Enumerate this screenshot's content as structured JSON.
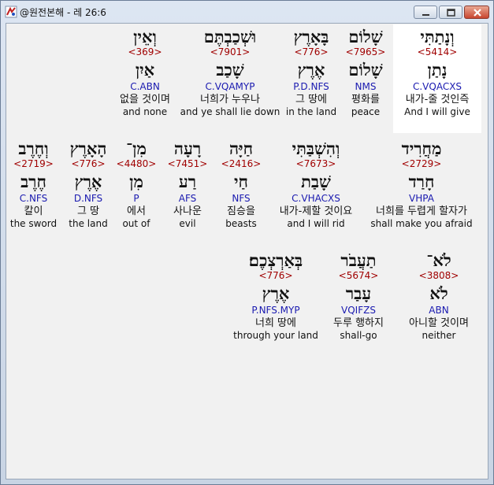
{
  "window": {
    "title": "@원전본해 - 레 26:6",
    "app_icon": "bible-app-icon",
    "buttons": {
      "minimize": "minimize-icon",
      "maximize": "maximize-icon",
      "close": "close-icon"
    }
  },
  "colors": {
    "strong": "#a00000",
    "morph": "#1a1ab0",
    "highlight": "#ffffff",
    "background": "#f1f1f1"
  },
  "words": [
    {
      "heb": "וְנָתַתִּי",
      "strong": "<5414>",
      "lemma": "נָתַן",
      "morph": "C.VQACXS",
      "kor": "내가-줄 것인즉",
      "eng": "And I will give",
      "selected": true
    },
    {
      "heb": "שָׁלוֹם",
      "strong": "<7965>",
      "lemma": "שָׁלוֹם",
      "morph": "NMS",
      "kor": "평화를",
      "eng": "peace"
    },
    {
      "heb": "בָּאָרֶץ",
      "strong": "<776>",
      "lemma": "אֶרֶץ",
      "morph": "P.D.NFS",
      "kor": "그 땅에",
      "eng": "in the land"
    },
    {
      "heb": "וּשְׁכַבְתֶּם",
      "strong": "<7901>",
      "lemma": "שָׁכַב",
      "morph": "C.VQAMYP",
      "kor": "너희가 누우나",
      "eng": "and ye shall lie down"
    },
    {
      "heb": "וְאֵין",
      "strong": "<369>",
      "lemma": "אַיִן",
      "morph": "C.ABN",
      "kor": "없을 것이며",
      "eng": "and none"
    },
    {
      "heb": "מַחֲרִיד",
      "strong": "<2729>",
      "lemma": "חָרַד",
      "morph": "VHPA",
      "kor": "너희를 두렵게 할자가",
      "eng": "shall make you afraid"
    },
    {
      "heb": "וְהִשְׁבַּתִּי",
      "strong": "<7673>",
      "lemma": "שָׁבַת",
      "morph": "C.VHACXS",
      "kor": "내가-제할 것이요",
      "eng": "and I will rid"
    },
    {
      "heb": "חַיָּה",
      "strong": "<2416>",
      "lemma": "חַי",
      "morph": "NFS",
      "kor": "짐승을",
      "eng": "beasts"
    },
    {
      "heb": "רָעָה",
      "strong": "<7451>",
      "lemma": "רַע",
      "morph": "AFS",
      "kor": "사나운",
      "eng": "evil"
    },
    {
      "heb": "מִן־",
      "strong": "<4480>",
      "lemma": "מִן",
      "morph": "P",
      "kor": "에서",
      "eng": "out of"
    },
    {
      "heb": "הָאָרֶץ",
      "strong": "<776>",
      "lemma": "אֶרֶץ",
      "morph": "D.NFS",
      "kor": "그 땅",
      "eng": "the land"
    },
    {
      "heb": "וְחֶרֶב",
      "strong": "<2719>",
      "lemma": "חֶרֶב",
      "morph": "C.NFS",
      "kor": "칼이",
      "eng": "the sword"
    },
    {
      "heb": "לֹא־",
      "strong": "<3808>",
      "lemma": "לֹא",
      "morph": "ABN",
      "kor": "아니할 것이며",
      "eng": "neither"
    },
    {
      "heb": "תַעֲבֹר",
      "strong": "<5674>",
      "lemma": "עָבַר",
      "morph": "VQIFZS",
      "kor": "두루 행하지",
      "eng": "shall-go"
    },
    {
      "heb": "בְּאַרְצְכֶם׃",
      "strong": "<776>",
      "lemma": "אֶרֶץ",
      "morph": "P.NFS.MYP",
      "kor": "너희 땅에",
      "eng": "through your land"
    }
  ]
}
